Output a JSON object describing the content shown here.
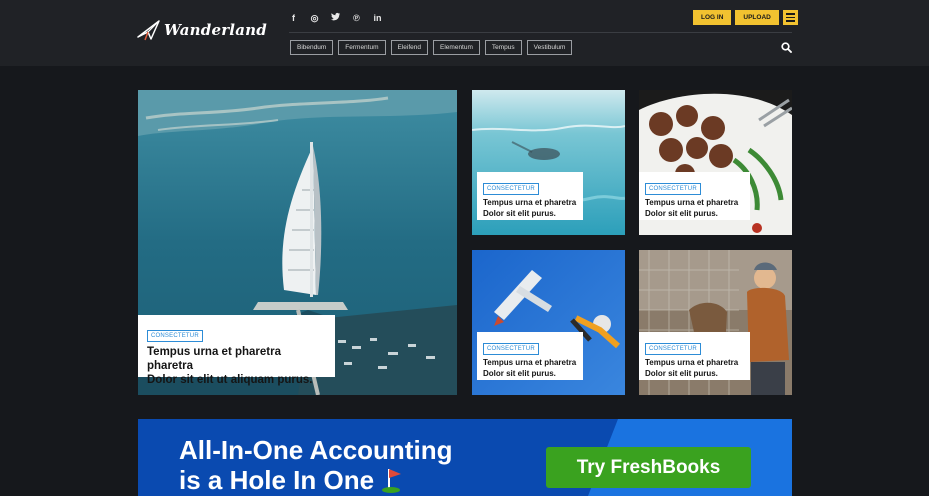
{
  "header": {
    "logo_text": "Wanderland",
    "social": [
      "f",
      "◎",
      "🐦",
      "℗",
      "in"
    ],
    "nav": [
      "Bibendum",
      "Fermentum",
      "Eleifend",
      "Elementum",
      "Tempus",
      "Vestibulum"
    ],
    "login_label": "LOG IN",
    "upload_label": "UPLOAD"
  },
  "featured": {
    "main": {
      "tag": "CONSECTETUR",
      "title_line1": "Tempus urna et pharetra pharetra",
      "title_line2": "Dolor sit elit ut aliquam purus."
    },
    "cards": [
      {
        "tag": "CONSECTETUR",
        "title_line1": "Tempus urna et pharetra",
        "title_line2": "Dolor sit elit purus."
      },
      {
        "tag": "CONSECTETUR",
        "title_line1": "Tempus urna et pharetra",
        "title_line2": "Dolor sit elit purus."
      },
      {
        "tag": "CONSECTETUR",
        "title_line1": "Tempus urna et pharetra",
        "title_line2": "Dolor sit elit purus."
      },
      {
        "tag": "CONSECTETUR",
        "title_line1": "Tempus urna et pharetra",
        "title_line2": "Dolor sit elit purus."
      }
    ]
  },
  "ad": {
    "headline_line1": "All-In-One Accounting",
    "headline_line2": "is a Hole In One",
    "cta": "Try FreshBooks"
  },
  "colors": {
    "accent": "#f2c230",
    "tag": "#2d8cd6",
    "ad_blue": "#0a4ab0",
    "cta_green": "#3aa21f"
  }
}
